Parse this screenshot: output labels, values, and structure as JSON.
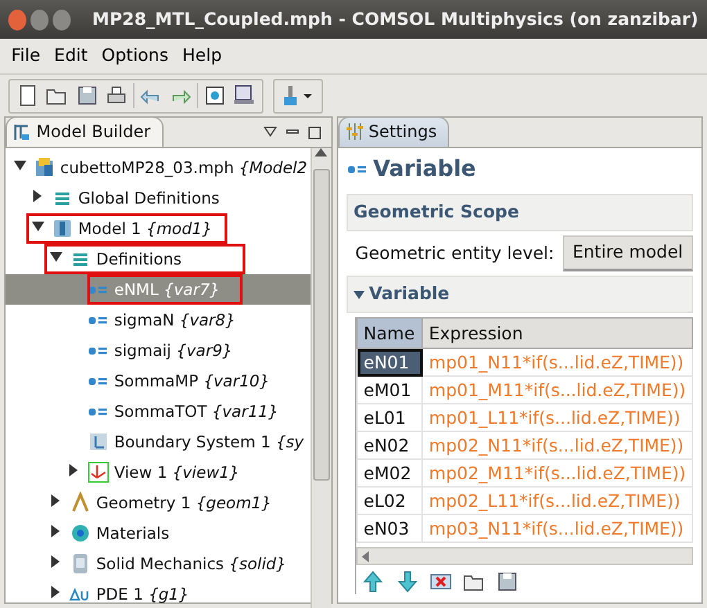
{
  "window": {
    "title": "MP28_MTL_Coupled.mph - COMSOL Multiphysics  (on zanzibar)"
  },
  "menu": [
    "File",
    "Edit",
    "Options",
    "Help"
  ],
  "model_builder": {
    "title": "Model Builder",
    "tree": [
      {
        "label": "cubettoMP28_03.mph *{Model2*",
        "kind": "file",
        "expanded": true,
        "selected": false,
        "annotated": false,
        "children": [
          {
            "label": "Global Definitions",
            "kind": "definitions",
            "expanded": false,
            "selected": false,
            "annotated": false
          },
          {
            "label": "Model 1 *{mod1}*",
            "kind": "model",
            "expanded": true,
            "selected": false,
            "annotated": true,
            "children": [
              {
                "label": "Definitions",
                "kind": "definitions",
                "expanded": true,
                "selected": false,
                "annotated": true,
                "children": [
                  {
                    "label": "eNML *{var7}*",
                    "kind": "variable",
                    "selected": true,
                    "annotated": true
                  },
                  {
                    "label": "sigmaN *{var8}*",
                    "kind": "variable",
                    "selected": false,
                    "annotated": false
                  },
                  {
                    "label": "sigmaij *{var9}*",
                    "kind": "variable",
                    "selected": false,
                    "annotated": false
                  },
                  {
                    "label": "SommaMP *{var10}*",
                    "kind": "variable",
                    "selected": false,
                    "annotated": false
                  },
                  {
                    "label": "SommaTOT *{var11}*",
                    "kind": "variable",
                    "selected": false,
                    "annotated": false
                  },
                  {
                    "label": "Boundary System 1 *{sy*",
                    "kind": "coordinates",
                    "selected": false,
                    "annotated": false
                  },
                  {
                    "label": "View 1 *{view1}*",
                    "kind": "view",
                    "expanded": false,
                    "selected": false,
                    "annotated": false
                  }
                ]
              },
              {
                "label": "Geometry 1 *{geom1}*",
                "kind": "geometry",
                "expanded": false,
                "selected": false,
                "annotated": false
              },
              {
                "label": "Materials",
                "kind": "materials",
                "expanded": false,
                "selected": false,
                "annotated": false
              },
              {
                "label": "Solid Mechanics *{solid}*",
                "kind": "physics",
                "expanded": false,
                "selected": false,
                "annotated": false
              },
              {
                "label": "PDE 1 *{g1}*",
                "kind": "pde",
                "expanded": false,
                "selected": false,
                "annotated": false
              }
            ]
          }
        ]
      }
    ]
  },
  "settings": {
    "tab": "Settings",
    "heading": "Variable",
    "geometric_scope": {
      "title": "Geometric Scope",
      "label": "Geometric entity level:",
      "value": "Entire model"
    },
    "variable_section": {
      "title": "Variable",
      "expanded": true,
      "columns": [
        "Name",
        "Expression"
      ],
      "rows": [
        {
          "name": "eN01",
          "expression": "mp01_N11*if(s...lid.eZ,TIME))",
          "selected": true
        },
        {
          "name": "eM01",
          "expression": "mp01_M11*if(s...lid.eZ,TIME))",
          "selected": false
        },
        {
          "name": "eL01",
          "expression": "mp01_L11*if(s...lid.eZ,TIME))",
          "selected": false
        },
        {
          "name": "eN02",
          "expression": "mp02_N11*if(s...lid.eZ,TIME))",
          "selected": false
        },
        {
          "name": "eM02",
          "expression": "mp02_M11*if(s...lid.eZ,TIME))",
          "selected": false
        },
        {
          "name": "eL02",
          "expression": "mp02_L11*if(s...lid.eZ,TIME))",
          "selected": false
        },
        {
          "name": "eN03",
          "expression": "mp03_N11*if(s...lid.eZ,TIME))",
          "selected": false
        }
      ]
    }
  }
}
